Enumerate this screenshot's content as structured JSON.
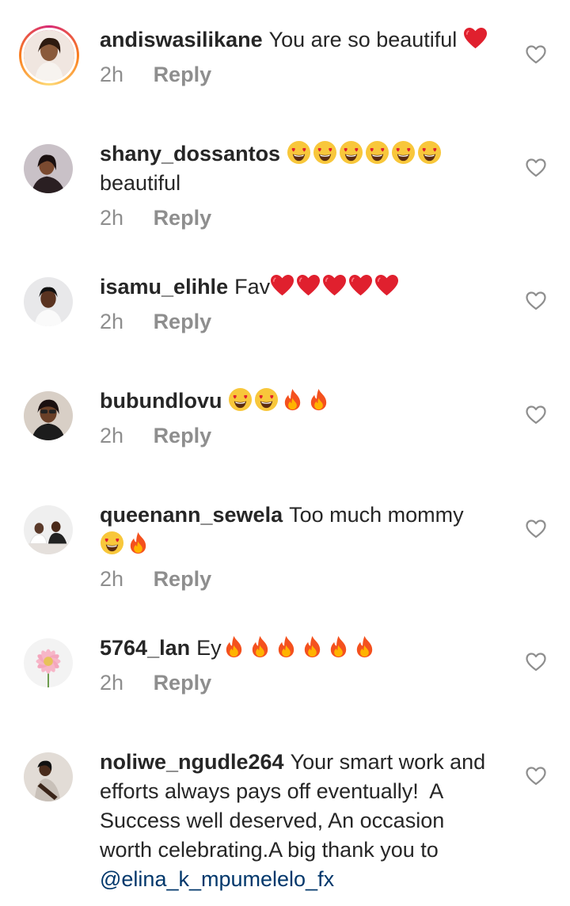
{
  "comments": [
    {
      "username": "andiswasilikane",
      "text": "You are so beautiful",
      "emojis": [
        "heart"
      ],
      "time": "2h",
      "reply": "Reply"
    },
    {
      "username": "shany_dossantos",
      "text": "",
      "emojis": [
        "heart-eyes",
        "heart-eyes",
        "heart-eyes",
        "heart-eyes",
        "heart-eyes",
        "heart-eyes"
      ],
      "text_after": "beautiful",
      "time": "2h",
      "reply": "Reply"
    },
    {
      "username": "isamu_elihle",
      "text": "Fav",
      "emojis": [
        "heart",
        "heart",
        "heart",
        "heart",
        "heart"
      ],
      "time": "2h",
      "reply": "Reply"
    },
    {
      "username": "bubundlovu",
      "text": "",
      "emojis": [
        "heart-eyes",
        "heart-eyes",
        "fire",
        "fire"
      ],
      "time": "2h",
      "reply": "Reply"
    },
    {
      "username": "queenann_sewela",
      "text": "Too much mommy",
      "emojis": [
        "heart-eyes",
        "fire"
      ],
      "time": "2h",
      "reply": "Reply"
    },
    {
      "username": "5764_lan",
      "text": "Ey",
      "emojis": [
        "fire",
        "fire",
        "fire",
        "fire",
        "fire",
        "fire"
      ],
      "time": "2h",
      "reply": "Reply"
    },
    {
      "username": "noliwe_ngudle264",
      "text_lines": [
        "Your smart work and",
        "efforts always pays off eventually!  A",
        "Success well deserved, An occasion",
        "worth celebrating.A big thank you to"
      ],
      "mention": "@elina_k_mpumelelo_fx"
    }
  ],
  "colors": {
    "text": "#262626",
    "secondary": "#8e8e8e",
    "mention": "#00376b",
    "heart": "#e0202e"
  },
  "icons": {
    "like": "heart-outline-icon"
  }
}
